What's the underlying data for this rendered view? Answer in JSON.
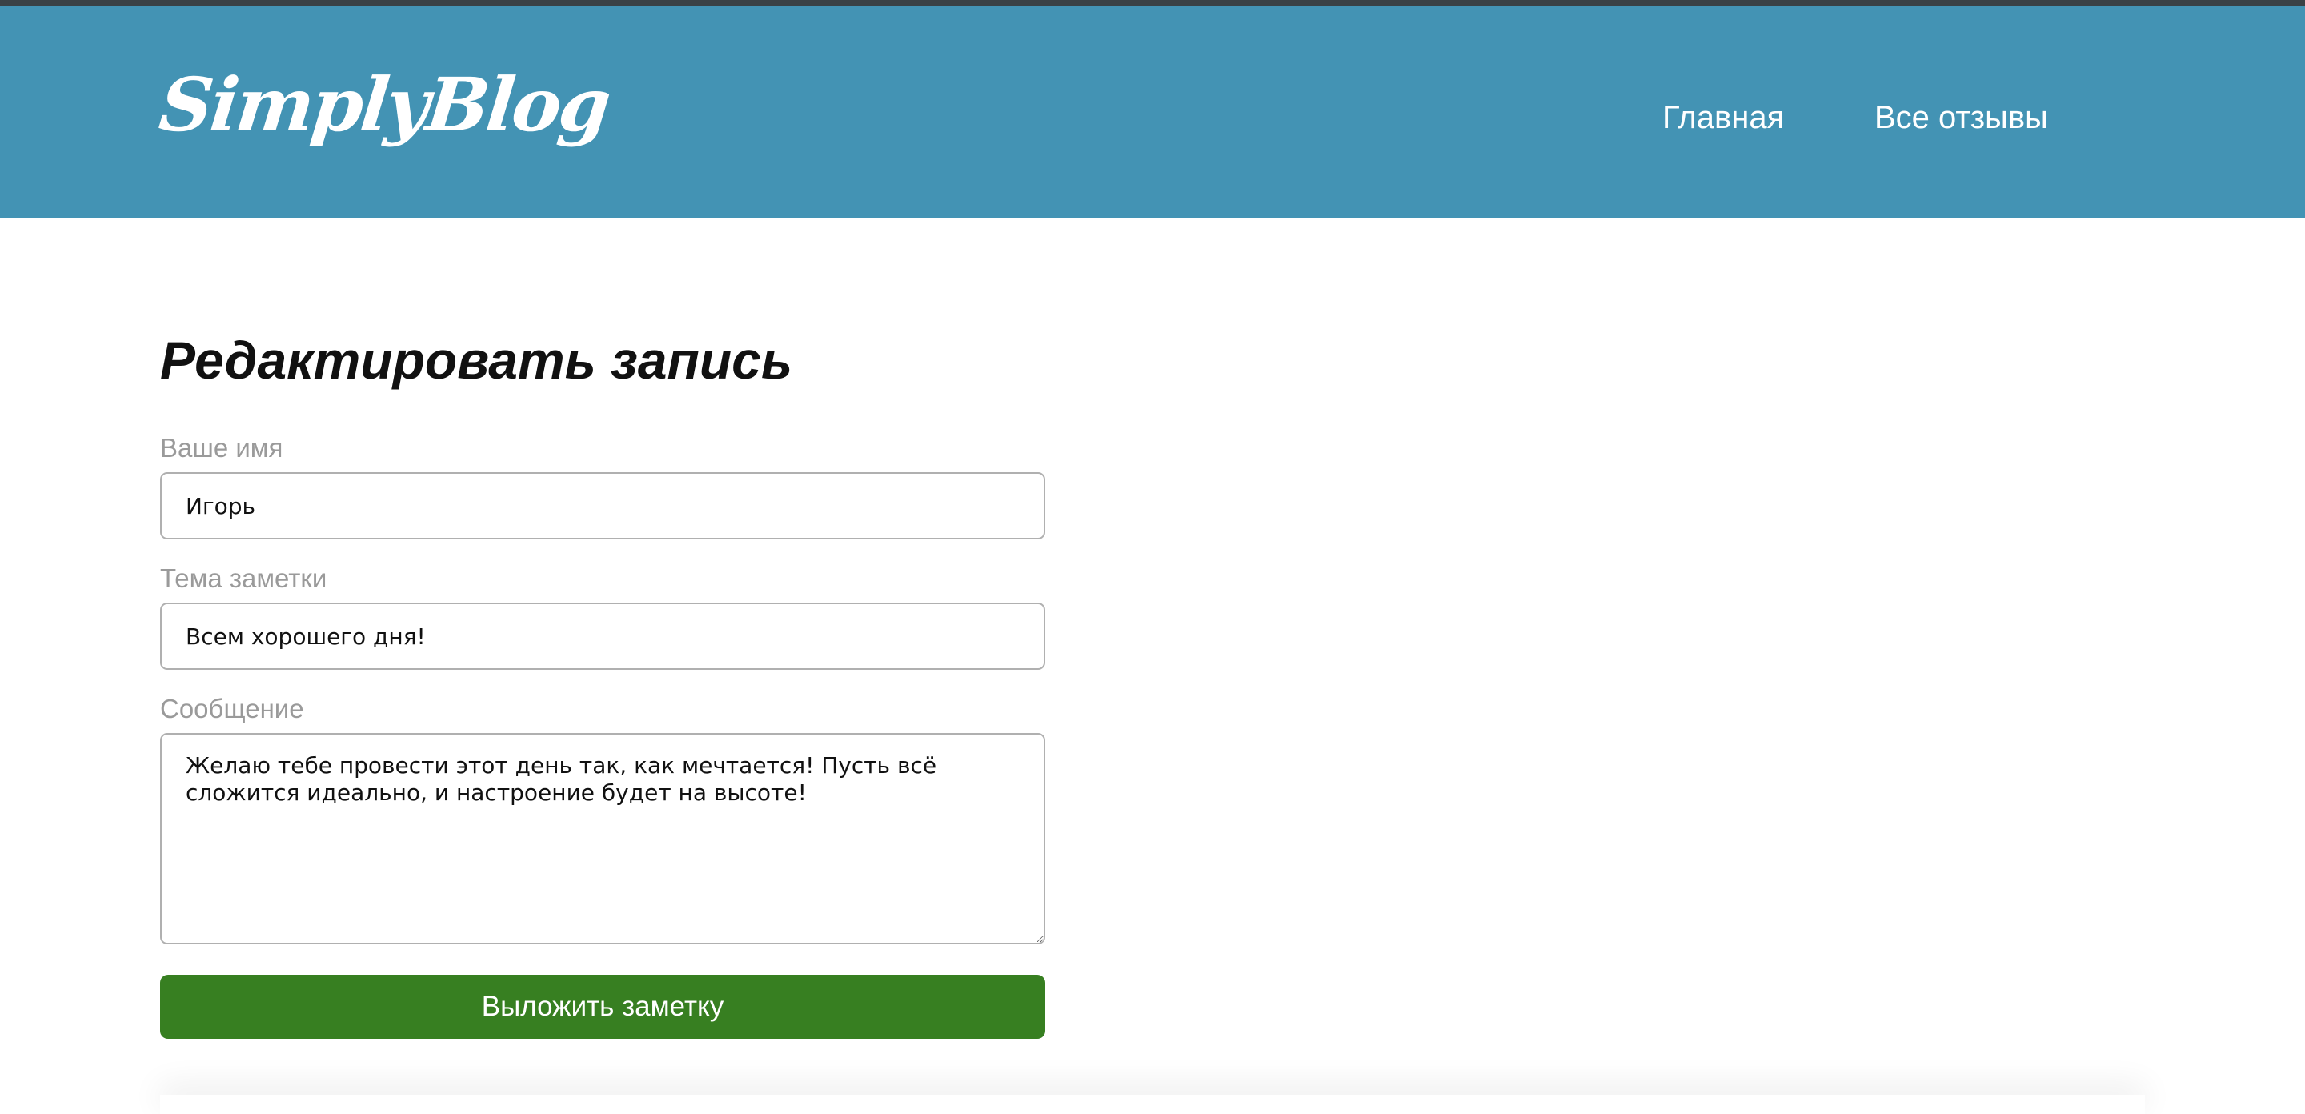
{
  "header": {
    "logo": "SimplyBlog",
    "nav": [
      {
        "label": "Главная"
      },
      {
        "label": "Все отзывы"
      }
    ],
    "background": "#4393b4"
  },
  "form": {
    "title": "Редактировать запись",
    "name_label": "Ваше имя",
    "name_value": "Игорь",
    "topic_label": "Тема заметки",
    "topic_value": "Всем хорошего дня!",
    "message_label": "Сообщение",
    "message_value": "Желаю тебе провести этот день так, как мечтается! Пусть всё сложится идеально, и настроение будет на высоте!",
    "submit_label": "Выложить заметку",
    "submit_color": "#377f21"
  }
}
